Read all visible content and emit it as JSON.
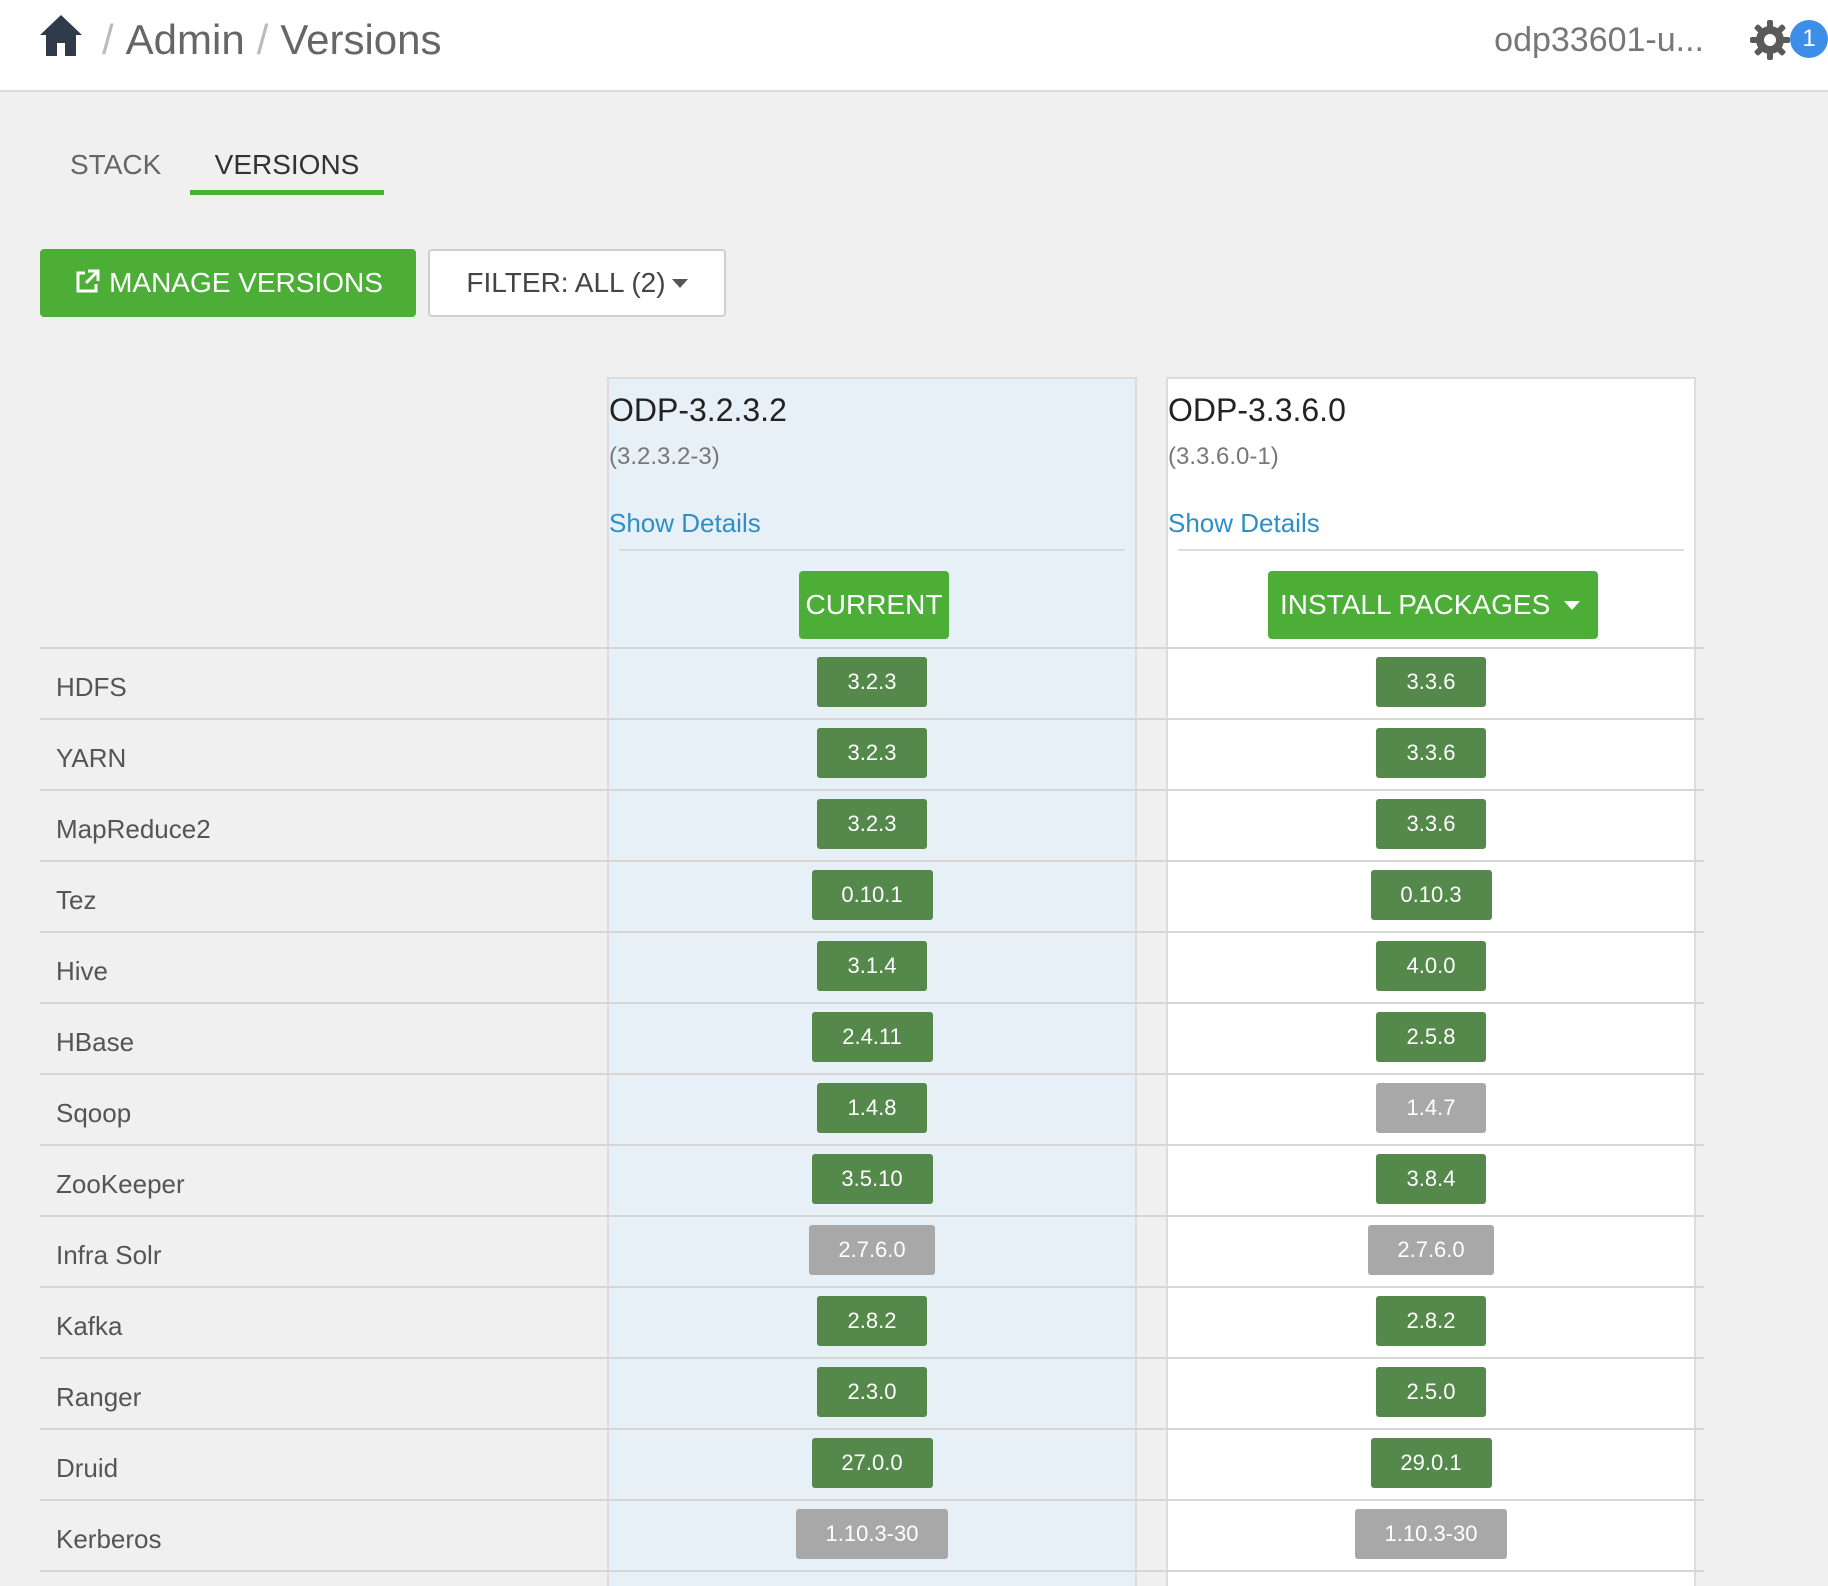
{
  "header": {
    "breadcrumb": [
      "Admin",
      "Versions"
    ],
    "breadcrumb_separator": "/",
    "user": "odp33601-u...",
    "notification_count": "1"
  },
  "tabs": [
    {
      "label": "STACK",
      "active": false
    },
    {
      "label": "VERSIONS",
      "active": true
    }
  ],
  "actions": {
    "manage_versions_label": "MANAGE VERSIONS",
    "filter_label": "FILTER: ALL (2)"
  },
  "versions": [
    {
      "name": "ODP-3.2.3.2",
      "build": "(3.2.3.2-3)",
      "details_link": "Show Details",
      "action_label": "CURRENT",
      "is_current": true
    },
    {
      "name": "ODP-3.3.6.0",
      "build": "(3.3.6.0-1)",
      "details_link": "Show Details",
      "action_label": "INSTALL PACKAGES",
      "is_current": false
    }
  ],
  "services": [
    {
      "name": "HDFS",
      "current": {
        "version": "3.2.3",
        "upgrade": true
      },
      "target": {
        "version": "3.3.6",
        "upgrade": true
      }
    },
    {
      "name": "YARN",
      "current": {
        "version": "3.2.3",
        "upgrade": true
      },
      "target": {
        "version": "3.3.6",
        "upgrade": true
      }
    },
    {
      "name": "MapReduce2",
      "current": {
        "version": "3.2.3",
        "upgrade": true
      },
      "target": {
        "version": "3.3.6",
        "upgrade": true
      }
    },
    {
      "name": "Tez",
      "current": {
        "version": "0.10.1",
        "upgrade": true
      },
      "target": {
        "version": "0.10.3",
        "upgrade": true
      }
    },
    {
      "name": "Hive",
      "current": {
        "version": "3.1.4",
        "upgrade": true
      },
      "target": {
        "version": "4.0.0",
        "upgrade": true
      }
    },
    {
      "name": "HBase",
      "current": {
        "version": "2.4.11",
        "upgrade": true
      },
      "target": {
        "version": "2.5.8",
        "upgrade": true
      }
    },
    {
      "name": "Sqoop",
      "current": {
        "version": "1.4.8",
        "upgrade": true
      },
      "target": {
        "version": "1.4.7",
        "upgrade": false
      }
    },
    {
      "name": "ZooKeeper",
      "current": {
        "version": "3.5.10",
        "upgrade": true
      },
      "target": {
        "version": "3.8.4",
        "upgrade": true
      }
    },
    {
      "name": "Infra Solr",
      "current": {
        "version": "2.7.6.0",
        "upgrade": false
      },
      "target": {
        "version": "2.7.6.0",
        "upgrade": false
      }
    },
    {
      "name": "Kafka",
      "current": {
        "version": "2.8.2",
        "upgrade": true
      },
      "target": {
        "version": "2.8.2",
        "upgrade": true
      }
    },
    {
      "name": "Ranger",
      "current": {
        "version": "2.3.0",
        "upgrade": true
      },
      "target": {
        "version": "2.5.0",
        "upgrade": true
      }
    },
    {
      "name": "Druid",
      "current": {
        "version": "27.0.0",
        "upgrade": true
      },
      "target": {
        "version": "29.0.1",
        "upgrade": true
      }
    },
    {
      "name": "Kerberos",
      "current": {
        "version": "1.10.3-30",
        "upgrade": false
      },
      "target": {
        "version": "1.10.3-30",
        "upgrade": false
      }
    }
  ],
  "colors": {
    "accent_green": "#4cae37",
    "version_green": "#55894c",
    "version_gray": "#a8a8a8",
    "link_blue": "#2f8fc4",
    "current_column_bg": "#e7f0f6",
    "badge_blue": "#3d8ee8"
  },
  "icons": {
    "home": "home-icon",
    "settings": "gear-icon",
    "manage": "external-link-icon",
    "dropdown": "caret-down-icon"
  }
}
